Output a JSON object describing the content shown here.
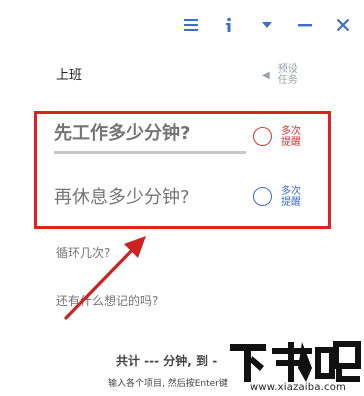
{
  "toolbar": {
    "icons": [
      "menu-icon",
      "info-icon",
      "dropdown-caret-icon",
      "minimize-icon",
      "close-icon"
    ],
    "color": "#3b6ecf"
  },
  "task": {
    "label": "上班"
  },
  "preset": {
    "label": "预设任务"
  },
  "work": {
    "placeholder": "先工作多少分钟?",
    "side_label": "多次提醒",
    "color": "#dd3333"
  },
  "rest": {
    "placeholder": "再休息多少分钟?",
    "side_label": "多次提醒",
    "color": "#3b6ecf"
  },
  "cycles": {
    "placeholder": "循环几次?"
  },
  "notes": {
    "placeholder": "还有什么想记的吗?"
  },
  "summary": {
    "total": "共计 --- 分钟, 到 -",
    "hint": "输入各个项目, 然后按Enter键"
  },
  "watermark": {
    "logo": "下载吧",
    "url": "www.xiazaiba.com"
  },
  "annotation": {
    "box_color": "#dd2222",
    "arrow_color": "#cc2222"
  }
}
